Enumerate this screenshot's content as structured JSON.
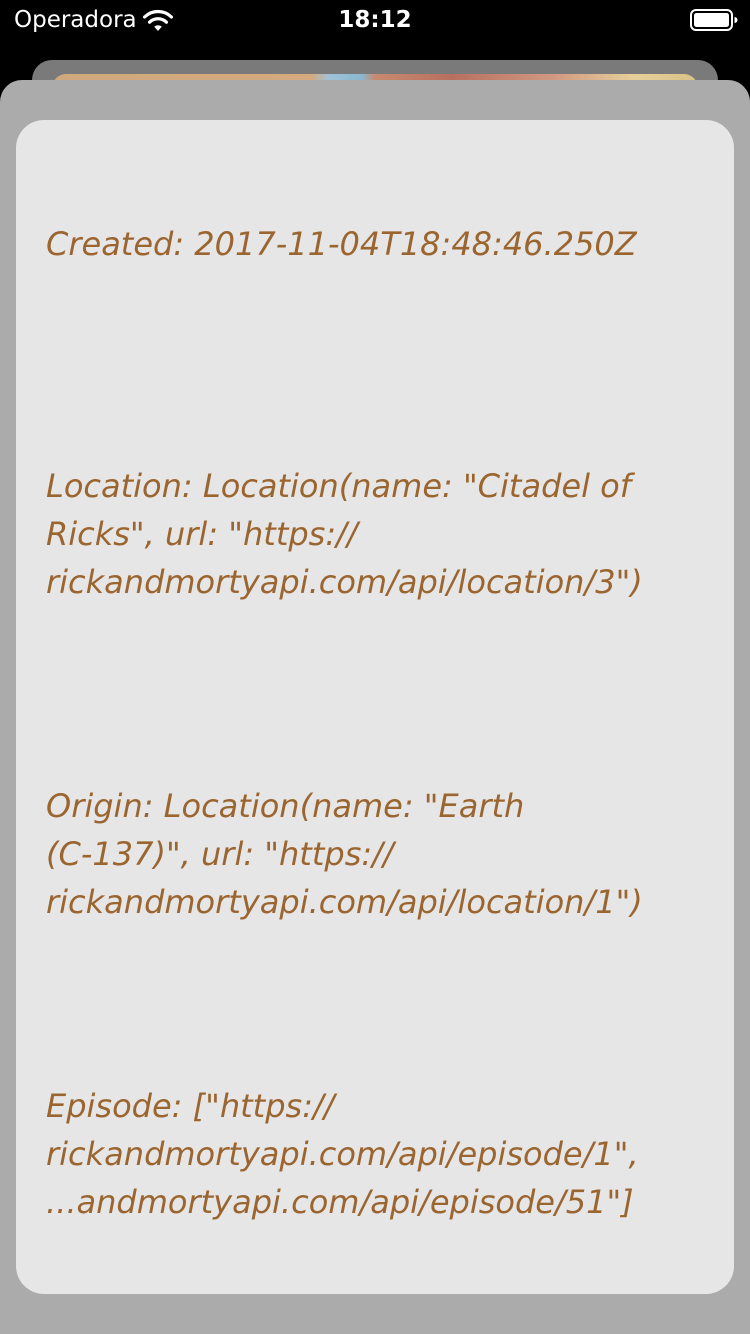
{
  "status_bar": {
    "carrier": "Operadora",
    "time": "18:12",
    "wifi_icon": "wifi-icon",
    "battery_icon": "battery-icon"
  },
  "detail": {
    "created": "Created: 2017-11-04T18:48:46.250Z",
    "location": "Location: Location(name: \"Citadel of\nRicks\", url: \"https://\nrickandmortyapi.com/api/location/3\")",
    "origin": "Origin: Location(name: \"Earth\n(C-137)\", url: \"https://\nrickandmortyapi.com/api/location/1\")",
    "episode": "Episode: [\"https://\nrickandmortyapi.com/api/episode/1\",\n...andmortyapi.com/api/episode/51\"]"
  },
  "colors": {
    "text_accent": "#9b6530",
    "card_background": "#e6e6e6",
    "sheet_background": "#ababab"
  }
}
